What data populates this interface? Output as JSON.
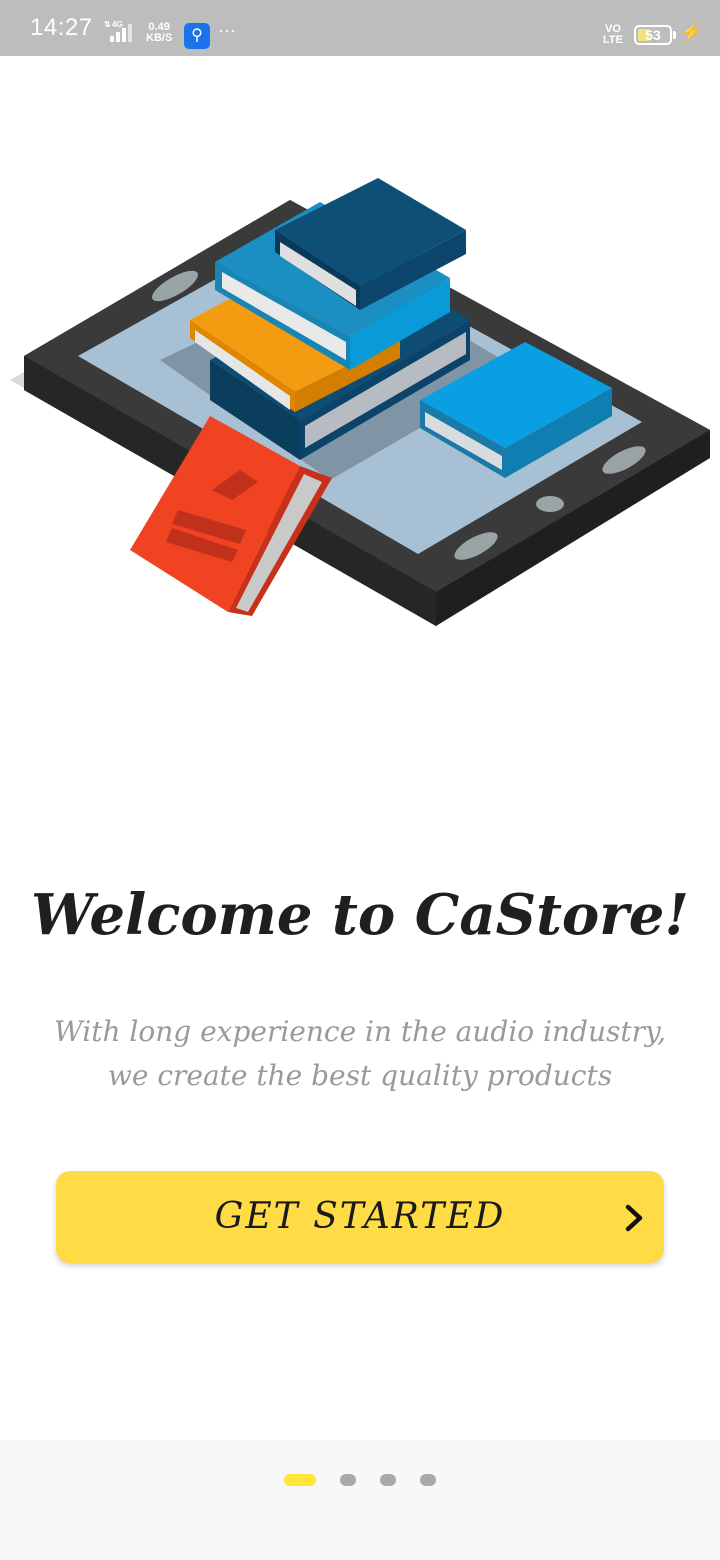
{
  "status_bar": {
    "time": "14:27",
    "network": "4G",
    "speed_value": "0.49",
    "speed_unit": "KB/S",
    "volte_top": "VO",
    "volte_bottom": "LTE",
    "battery": "53",
    "icons": [
      "signal-icon",
      "usb-icon",
      "more-icon",
      "battery-icon",
      "charging-icon"
    ]
  },
  "hero": {
    "image": "books-on-tablet-illustration"
  },
  "welcome": {
    "title": "Welcome to CaStore!",
    "subtitle_line1": "With long experience in the audio industry,",
    "subtitle_line2": "we create the best quality products"
  },
  "cta": {
    "label": "GET STARTED",
    "icon": "chevron-right-icon"
  },
  "pager": {
    "count": 4,
    "active_index": 0
  },
  "colors": {
    "accent": "#ffdc46",
    "active_dot": "#ffe43a",
    "inactive_dot": "#a9a9a9"
  }
}
